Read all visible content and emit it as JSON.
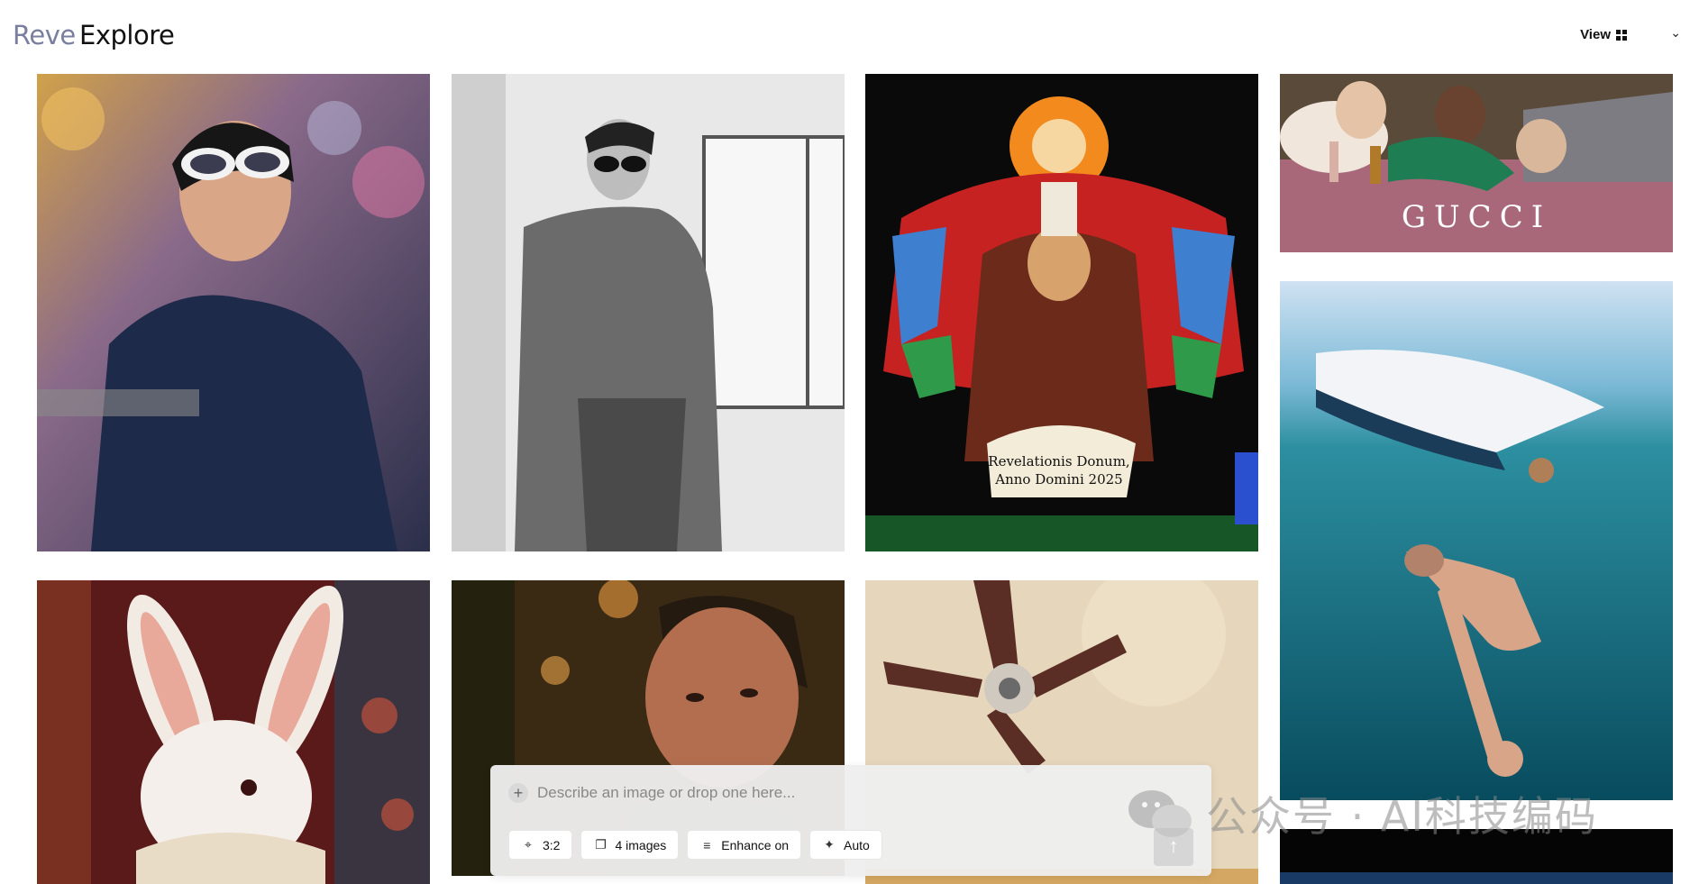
{
  "header": {
    "brand": "Reve",
    "title": "Explore",
    "view_label": "View"
  },
  "gallery": {
    "tiles": [
      {
        "name": "tile-man-sunglasses-motorcycle",
        "alt": "Young man with white sunglasses on motorcycle"
      },
      {
        "name": "tile-bw-man-leaning-wall",
        "alt": "Black and white man leaning on wall"
      },
      {
        "name": "tile-stained-glass",
        "alt": "Stained glass window",
        "caption_lines": [
          "Revelationis Donum,",
          "Anno Domini 2025"
        ]
      },
      {
        "name": "tile-gucci-ad",
        "alt": "Fashion ad with three models",
        "brand_text": "GUCCI"
      },
      {
        "name": "tile-underwater-swimmer",
        "alt": "Swimmer underwater below boat"
      },
      {
        "name": "tile-white-rabbit",
        "alt": "White rabbit with ruffled collar"
      },
      {
        "name": "tile-man-portrait",
        "alt": "Man in dim lit scene"
      },
      {
        "name": "tile-ceiling-fan",
        "alt": "Ceiling fan"
      },
      {
        "name": "tile-dark-partial",
        "alt": "Dark partial image"
      }
    ]
  },
  "prompt_bar": {
    "placeholder": "Describe an image or drop one here...",
    "chips": [
      {
        "icon": "crop-icon",
        "label": "3:2"
      },
      {
        "icon": "images-icon",
        "label": "4 images"
      },
      {
        "icon": "enhance-icon",
        "label": "Enhance on"
      },
      {
        "icon": "auto-icon",
        "label": "Auto"
      }
    ]
  },
  "watermark": {
    "text": "公众号 · AI科技编码"
  }
}
